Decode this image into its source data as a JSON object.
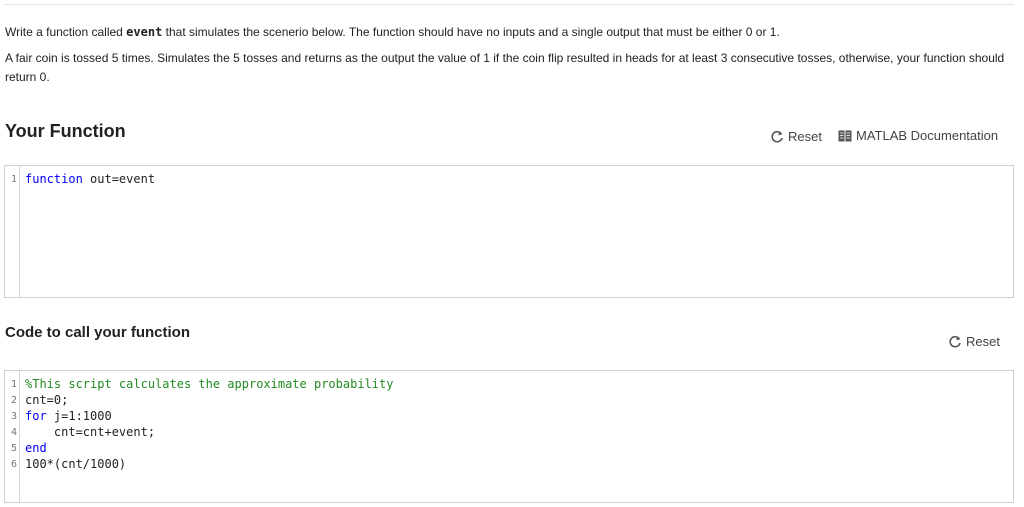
{
  "problem": {
    "p1_prefix": "Write a function called ",
    "p1_code": "event",
    "p1_suffix": " that simulates the scenerio below. The function should have no inputs and a single output that must be either 0 or 1.",
    "p2": "A fair coin is tossed 5 times. Simulates the 5 tosses and returns as the output the value of 1 if the coin flip resulted in heads for at least 3 consecutive tosses, otherwise, your function should return 0."
  },
  "your_function": {
    "title": "Your Function",
    "reset_label": "Reset",
    "doc_label": "MATLAB Documentation",
    "code": {
      "l1_num": "1",
      "l1_kw": "function",
      "l1_rest": " out=event"
    }
  },
  "call_code": {
    "title": "Code to call your function",
    "reset_label": "Reset",
    "lines": {
      "l1_num": "1",
      "l1_comment": "%This script calculates the approximate probability",
      "l2_num": "2",
      "l2_text": "cnt=0;",
      "l3_num": "3",
      "l3_kw": "for",
      "l3_rest": " j=1:1000",
      "l4_num": "4",
      "l4_text": "    cnt=cnt+event;",
      "l5_num": "5",
      "l5_kw": "end",
      "l6_num": "6",
      "l6_text": "100*(cnt/1000)"
    }
  },
  "colors": {
    "keyword": "#0000ff",
    "comment": "#228b22",
    "border": "#cfcfcf"
  }
}
